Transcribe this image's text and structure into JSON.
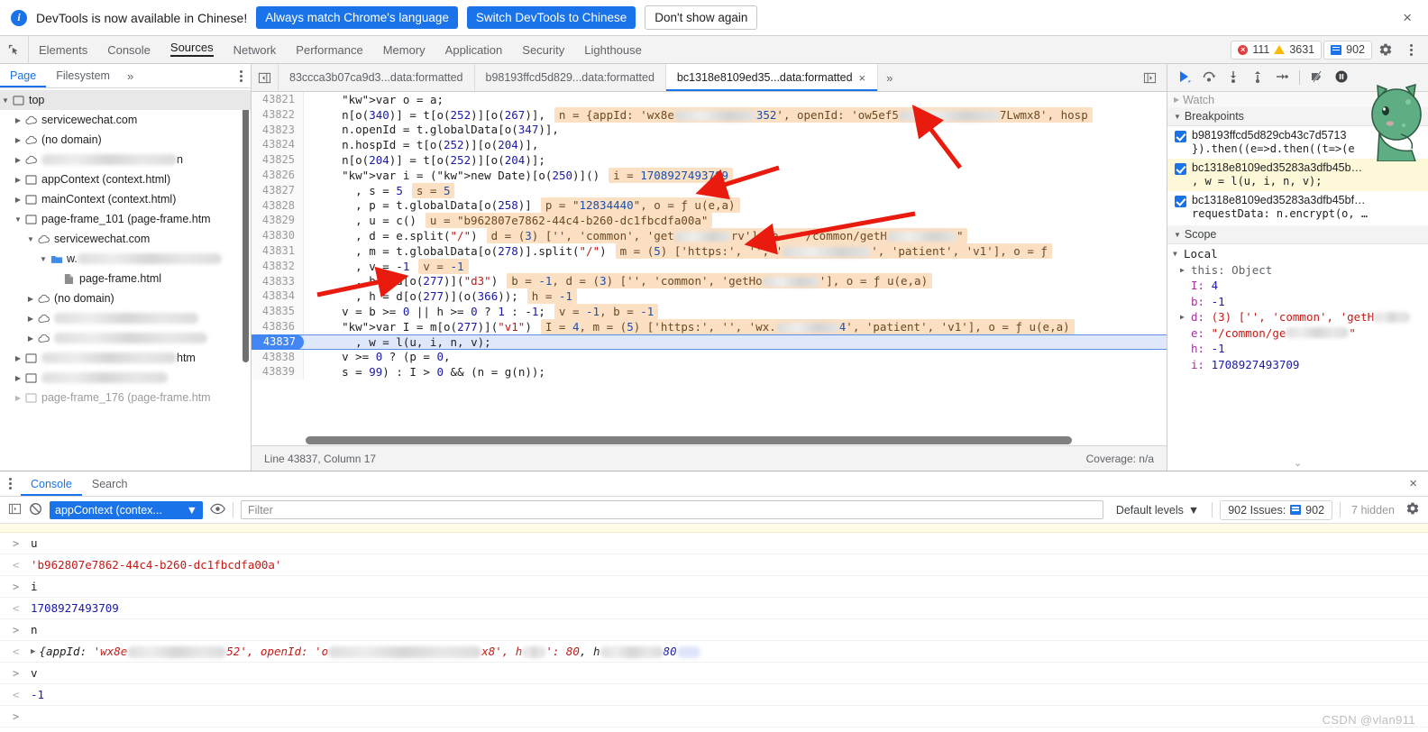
{
  "infobar": {
    "message": "DevTools is now available in Chinese!",
    "buttons": [
      {
        "label": "Always match Chrome's language",
        "style": "blue"
      },
      {
        "label": "Switch DevTools to Chinese",
        "style": "blue"
      },
      {
        "label": "Don't show again",
        "style": "white"
      }
    ],
    "close_label": "×"
  },
  "main_tabs": {
    "items": [
      "Elements",
      "Console",
      "Sources",
      "Network",
      "Performance",
      "Memory",
      "Application",
      "Security",
      "Lighthouse"
    ],
    "active": "Sources",
    "error_count": "111",
    "warning_count": "3631",
    "issue_count": "902",
    "settings_icon": "gear-icon",
    "more_icon": "kebab-icon"
  },
  "navigator": {
    "tabs": [
      "Page",
      "Filesystem"
    ],
    "active_tab": "Page",
    "overflow": "»",
    "tree": [
      {
        "label": "top",
        "icon": "frame-icon",
        "depth": 0,
        "state": "open",
        "selected": true
      },
      {
        "label": "servicewechat.com",
        "icon": "cloud-icon",
        "depth": 1,
        "state": "closed"
      },
      {
        "label": "(no domain)",
        "icon": "cloud-icon",
        "depth": 1,
        "state": "closed"
      },
      {
        "label": "",
        "icon": "cloud-icon",
        "depth": 1,
        "state": "closed",
        "redacted": 150,
        "tail": "n"
      },
      {
        "label": "appContext (context.html)",
        "icon": "frame-icon",
        "depth": 1,
        "state": "closed"
      },
      {
        "label": "mainContext (context.html)",
        "icon": "frame-icon",
        "depth": 1,
        "state": "closed"
      },
      {
        "label": "page-frame_101 (page-frame.htm",
        "icon": "frame-icon",
        "depth": 1,
        "state": "open"
      },
      {
        "label": "servicewechat.com",
        "icon": "cloud-icon",
        "depth": 2,
        "state": "open"
      },
      {
        "label": "w.",
        "icon": "folder-icon",
        "depth": 3,
        "state": "open",
        "redacted": 160
      },
      {
        "label": "page-frame.html",
        "icon": "file-icon",
        "depth": 4,
        "state": "none"
      },
      {
        "label": "(no domain)",
        "icon": "cloud-icon",
        "depth": 2,
        "state": "closed"
      },
      {
        "label": "",
        "icon": "cloud-icon",
        "depth": 2,
        "state": "closed",
        "redacted": 160
      },
      {
        "label": "",
        "icon": "cloud-icon",
        "depth": 2,
        "state": "closed",
        "redacted": 170
      },
      {
        "label": "",
        "icon": "frame-icon",
        "depth": 1,
        "state": "closed",
        "redacted": 150,
        "tail": "htm"
      },
      {
        "label": "",
        "icon": "frame-icon",
        "depth": 1,
        "state": "closed",
        "redacted": 140
      },
      {
        "label": "page-frame_176 (page-frame.htm",
        "icon": "frame-icon",
        "depth": 1,
        "state": "closed",
        "dim": true
      }
    ]
  },
  "file_tabs": {
    "items": [
      {
        "label": "83ccca3b07ca9d3...data:formatted",
        "active": false,
        "closable": false
      },
      {
        "label": "b98193ffcd5d829...data:formatted",
        "active": false,
        "closable": false
      },
      {
        "label": "bc1318e8109ed35...data:formatted",
        "active": true,
        "closable": true
      }
    ],
    "overflow": "»"
  },
  "code": {
    "lines": [
      {
        "n": "43821",
        "text": "    var o = a;"
      },
      {
        "n": "43822",
        "text": "    n[o(340)] = t[o(252)][o(267)],",
        "value": "n = {appId: 'wx8e             352', openId: 'ow5ef5                7Lwmx8', hosp"
      },
      {
        "n": "43823",
        "text": "    n.openId = t.globalData[o(347)],"
      },
      {
        "n": "43824",
        "text": "    n.hospId = t[o(252)][o(204)],"
      },
      {
        "n": "43825",
        "text": "    n[o(204)] = t[o(252)][o(204)];"
      },
      {
        "n": "43826",
        "text": "    var i = (new Date)[o(250)]()",
        "value": "i = 1708927493709"
      },
      {
        "n": "43827",
        "text": "      , s = 5",
        "value": "s = 5"
      },
      {
        "n": "43828",
        "text": "      , p = t.globalData[o(258)]",
        "value": "p = \"12834440\", o = ƒ u(e,a)"
      },
      {
        "n": "43829",
        "text": "      , u = c()",
        "value": "u = \"b962807e7862-44c4-b260-dc1fbcdfa00a\""
      },
      {
        "n": "43830",
        "text": "      , d = e.split(\"/\")",
        "value": "d = (3) ['', 'common', 'get         rv'], e = \"/common/getH           \""
      },
      {
        "n": "43831",
        "text": "      , m = t.globalData[o(278)].split(\"/\")",
        "value": "m = (5) ['https:', '', '              ', 'patient', 'v1'], o = ƒ"
      },
      {
        "n": "43832",
        "text": "      , v = -1",
        "value": "v = -1"
      },
      {
        "n": "43833",
        "text": "      , b = d[o(277)](\"d3\")",
        "value": "b = -1, d = (3) ['', 'common', 'getHo         '], o = ƒ u(e,a)"
      },
      {
        "n": "43834",
        "text": "      , h = d[o(277)](o(366));",
        "value": "h = -1"
      },
      {
        "n": "43835",
        "text": "    v = b >= 0 || h >= 0 ? 1 : -1;",
        "value": "v = -1, b = -1"
      },
      {
        "n": "43836",
        "text": "    var I = m[o(277)](\"v1\")",
        "value": "I = 4, m = (5) ['https:', '', 'wx.          4', 'patient', 'v1'], o = ƒ u(e,a)"
      },
      {
        "n": "43837",
        "text": "      , w = l(u, i, n, v);",
        "current": true
      },
      {
        "n": "43838",
        "text": "    v >= 0 ? (p = 0,"
      },
      {
        "n": "43839",
        "text": "    s = 99) : I > 0 && (n = g(n));"
      }
    ]
  },
  "status": {
    "position": "Line 43837, Column 17",
    "coverage": "Coverage: n/a"
  },
  "debugger": {
    "toolbar_icons": [
      "resume-icon",
      "step-over-icon",
      "step-into-icon",
      "step-out-icon",
      "step-icon",
      "deactivate-breakpoints-icon",
      "pause-on-exceptions-icon"
    ],
    "watch_label": "Watch",
    "breakpoints_label": "Breakpoints",
    "breakpoints": [
      {
        "file": "b98193ffcd5d829cb43c7d5713",
        "snippet": "}).then((e=>d.then((t=>(e",
        "checked": true,
        "highlighted": false
      },
      {
        "file": "bc1318e8109ed35283a3dfb45b…",
        "snippet": ", w = l(u, i, n, v);",
        "checked": true,
        "highlighted": true
      },
      {
        "file": "bc1318e8109ed35283a3dfb45bf…",
        "snippet": "requestData: n.encrypt(o, …",
        "checked": true,
        "highlighted": false
      }
    ],
    "scope_label": "Scope",
    "scope_group": "Local",
    "scope_vars": [
      {
        "key": "this",
        "value": "Object",
        "kind": "obj",
        "expandable": true,
        "plainkey": true
      },
      {
        "key": "I",
        "value": "4",
        "kind": "num",
        "expandable": false
      },
      {
        "key": "b",
        "value": "-1",
        "kind": "num",
        "expandable": false
      },
      {
        "key": "d",
        "value": "(3) ['', 'common', 'getH",
        "kind": "mixed",
        "expandable": true,
        "redacted": 40
      },
      {
        "key": "e",
        "value": "\"/common/ge",
        "kind": "str",
        "expandable": false,
        "redacted": 70,
        "tail": "\""
      },
      {
        "key": "h",
        "value": "-1",
        "kind": "num",
        "expandable": false
      },
      {
        "key": "i",
        "value": "1708927493709",
        "kind": "num",
        "expandable": false
      }
    ]
  },
  "drawer": {
    "tabs": [
      "Console",
      "Search"
    ],
    "active_tab": "Console",
    "close_label": "×",
    "context": "appContext (contex...",
    "filter_placeholder": "Filter",
    "levels": "Default levels",
    "issues_text": "902 Issues:",
    "issues_count": "902",
    "hidden_text": "7 hidden",
    "eye_icon": "eye-icon",
    "clear_icon": "clear-console-icon",
    "sidebar_icon": "console-sidebar-icon",
    "settings_icon": "gear-icon"
  },
  "console_rows": [
    {
      "type": "warn-partial",
      "text": "",
      "partial": true
    },
    {
      "type": "input",
      "text": "u"
    },
    {
      "type": "output",
      "text": "'b962807e7862-44c4-b260-dc1fbcdfa00a'",
      "style": "str"
    },
    {
      "type": "input",
      "text": "i"
    },
    {
      "type": "output",
      "text": "1708927493709",
      "style": "num"
    },
    {
      "type": "input",
      "text": "n"
    },
    {
      "type": "output-object",
      "prefix": "{appId: ",
      "k1": "'wx8e",
      "mid1": "52', openId: 'o",
      "k2": "x8', h",
      "k3": "': 80",
      "k4": ", h",
      "k5": "80",
      "style": "obj"
    },
    {
      "type": "input",
      "text": "v"
    },
    {
      "type": "output",
      "text": "-1",
      "style": "num"
    },
    {
      "type": "prompt",
      "text": ""
    }
  ],
  "watermark": "CSDN @vlan911",
  "colors": {
    "accent": "#1a73e8",
    "error": "#e33e3e",
    "warning": "#fabb05",
    "inline_value_bg": "#fbe0c4",
    "current_line_bg": "#dfe8fb",
    "breakpoint_highlight": "#fdf8d8",
    "annotation_arrow": "#e81b0e"
  }
}
